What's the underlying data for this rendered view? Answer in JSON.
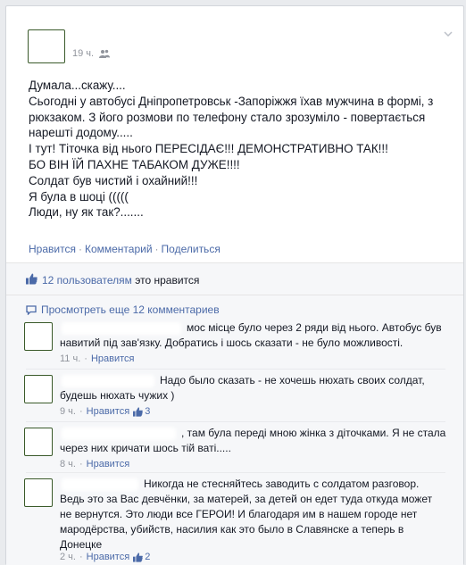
{
  "post": {
    "time": "19 ч.",
    "lines": [
      "Думала...скажу....",
      "Сьогодні у автобусі Дніпропетровськ -Запоріжжя їхав мужчина в формі, з",
      "рюкзаком. З його розмови по телефону стало зрозуміло - повертається",
      "нарешті додому.....",
      "І тут! Тіточка від нього ПЕРЕСІДАЄ!!! ДЕМОНСТРАТИВНО ТАК!!!",
      "БО ВІН ЇЙ ПАХНЕ ТАБАКОМ ДУЖЕ!!!!",
      "Солдат був чистий і охайний!!!",
      "Я була в шоці (((((",
      "Люди, ну як так?......."
    ],
    "actions": {
      "like": "Нравится",
      "comment": "Комментарий",
      "share": "Поделиться"
    }
  },
  "likes": {
    "count": "12 пользователям",
    "suffix": " это нравится"
  },
  "view_more": "Просмотреть еще 12 комментариев",
  "comments": [
    {
      "lines": [
        "мос місце було через 2 ряди від нього. Автобус був",
        "навитий під зав'язку. Добратись і шось сказати - не було можливості."
      ],
      "time": "11 ч.",
      "like": "Нравится",
      "likes": ""
    },
    {
      "lines": [
        "Надо было сказать - не хочешь нюхать своих солдат,",
        "будешь нюхать чужих )"
      ],
      "time": "9 ч.",
      "like": "Нравится",
      "likes": "3"
    },
    {
      "lines": [
        ", там була переді мною жінка з діточками. Я не стала",
        "через них кричати шось тій ваті....."
      ],
      "time": "8 ч.",
      "like": "Нравится",
      "likes": ""
    },
    {
      "lines": [
        "Никогда не стесняйтесь заводить с солдатом разговор.",
        "Ведь это за Вас девчёнки, за матерей, за детей он едет туда откуда может",
        "не вернутся. Это люди все ГЕРОИ! И благодаря им в нашем городе нет",
        "мародёрства, убийств, насилия как это было в Славянске а теперь в",
        "Донецке"
      ],
      "time": "2 ч.",
      "like": "Нравится",
      "likes": "2"
    }
  ],
  "colors": {
    "link": "#4b6aa8",
    "meta": "#90949c",
    "text": "#141823",
    "bar_bg": "#f6f7f9"
  }
}
